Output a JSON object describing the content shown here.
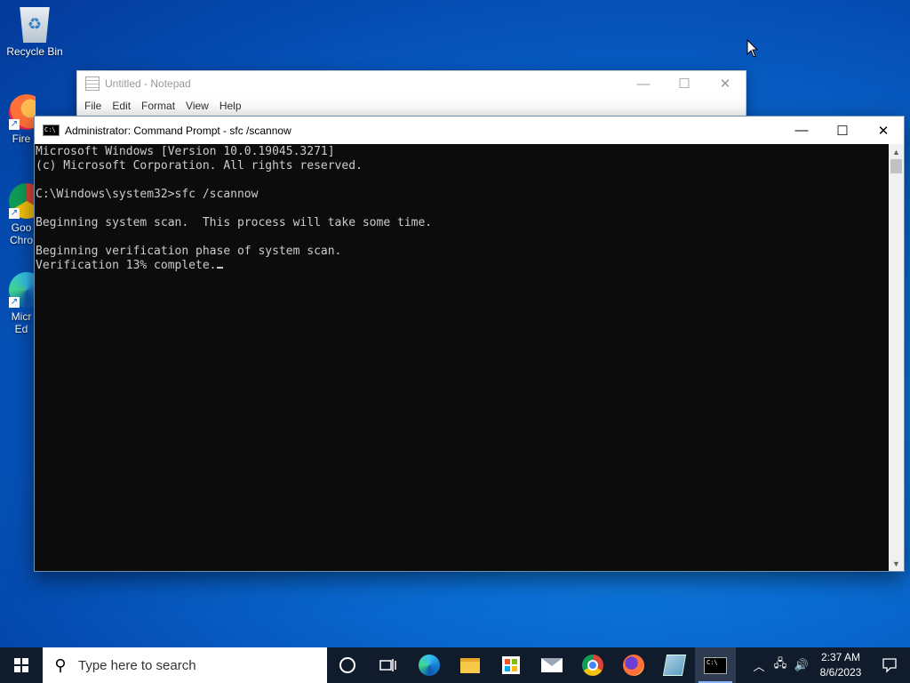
{
  "desktop": {
    "icons": [
      {
        "label": "Recycle Bin"
      },
      {
        "label": "Fire"
      },
      {
        "label": "Goo Chro"
      },
      {
        "label": "Micr Ed"
      }
    ]
  },
  "notepad": {
    "title": "Untitled - Notepad",
    "menu": [
      "File",
      "Edit",
      "Format",
      "View",
      "Help"
    ]
  },
  "cmd": {
    "title": "Administrator:  Command Prompt - sfc  /scannow",
    "icon_text": "C:\\",
    "lines": [
      "Microsoft Windows [Version 10.0.19045.3271]",
      "(c) Microsoft Corporation. All rights reserved.",
      "",
      "C:\\Windows\\system32>sfc /scannow",
      "",
      "Beginning system scan.  This process will take some time.",
      "",
      "Beginning verification phase of system scan.",
      "Verification 13% complete."
    ]
  },
  "taskbar": {
    "search_placeholder": "Type here to search",
    "apps": [
      "cortana-icon",
      "task-view-icon",
      "edge-icon",
      "file-explorer-icon",
      "store-icon",
      "mail-icon",
      "chrome-icon",
      "firefox-icon",
      "notepad-icon",
      "cmd-icon"
    ],
    "active_app": "cmd-icon",
    "time": "2:37 AM",
    "date": "8/6/2023"
  }
}
